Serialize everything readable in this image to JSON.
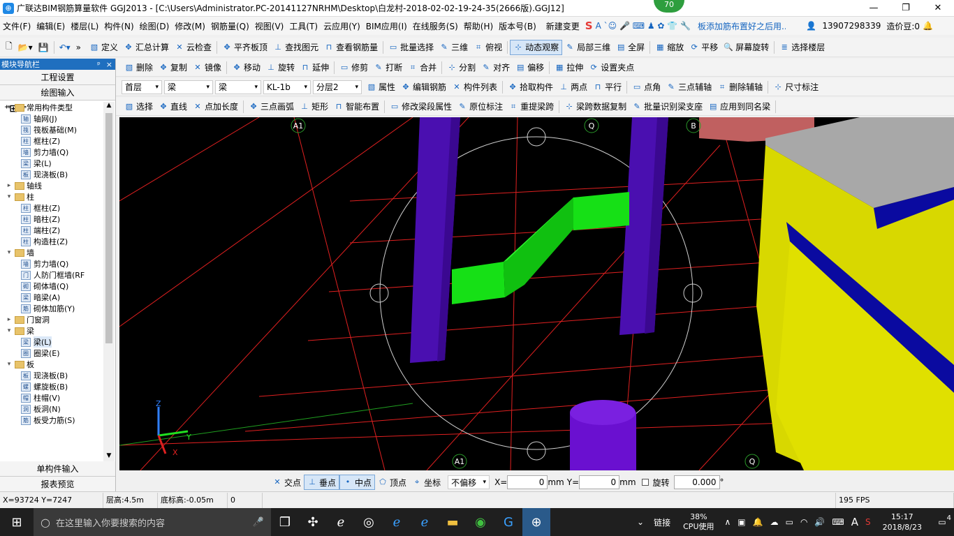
{
  "titlebar": {
    "title": "广联达BIM钢筋算量软件 GGJ2013 - [C:\\Users\\Administrator.PC-20141127NRHM\\Desktop\\白龙村-2018-02-02-19-24-35(2666版).GGJ12]",
    "minimize": "—",
    "maximize": "❐",
    "close": "✕",
    "badge": "70"
  },
  "menubar": {
    "items": [
      "文件(F)",
      "编辑(E)",
      "楼层(L)",
      "构件(N)",
      "绘图(D)",
      "修改(M)",
      "钢筋量(Q)",
      "视图(V)",
      "工具(T)",
      "云应用(Y)",
      "BIM应用(I)",
      "在线服务(S)",
      "帮助(H)",
      "版本号(B)"
    ],
    "news": "新建变更",
    "ad": "板添加筋布置好之后用...",
    "phone": "13907298339",
    "coins": "造价豆:0"
  },
  "toolbar1": {
    "items": [
      "定义",
      "汇总计算",
      "云检查",
      "平齐板顶",
      "查找图元",
      "查看钢筋量",
      "批量选择",
      "三维",
      "俯视",
      "动态观察",
      "局部三维",
      "全屏",
      "缩放",
      "平移",
      "屏幕旋转",
      "选择楼层"
    ]
  },
  "toolbar2": {
    "items": [
      "删除",
      "复制",
      "镜像",
      "移动",
      "旋转",
      "延伸",
      "修剪",
      "打断",
      "合并",
      "分割",
      "对齐",
      "偏移",
      "拉伸",
      "设置夹点"
    ]
  },
  "toolbar3": {
    "floor": "首层",
    "category": "梁",
    "type": "梁",
    "member": "KL-1b",
    "layer": "分层2",
    "items": [
      "属性",
      "编辑钢筋",
      "构件列表",
      "拾取构件",
      "两点",
      "平行",
      "点角",
      "三点辅轴",
      "删除辅轴",
      "尺寸标注"
    ]
  },
  "toolbar4": {
    "items": [
      "选择",
      "直线",
      "点加长度",
      "三点画弧",
      "矩形",
      "智能布置",
      "修改梁段属性",
      "原位标注",
      "重提梁跨",
      "梁跨数据复制",
      "批量识别梁支座",
      "应用到同名梁"
    ]
  },
  "nav": {
    "header": "模块导航栏",
    "pin": "ᵖ",
    "close": "×",
    "btn_project": "工程设置",
    "btn_draw": "绘图输入",
    "btn_single": "单构件输入",
    "btn_report": "报表预览",
    "tree": [
      {
        "level": 0,
        "exp": "▾",
        "folder": true,
        "label": "常用构件类型"
      },
      {
        "level": 1,
        "icon": "轴",
        "label": "轴网(J)"
      },
      {
        "level": 1,
        "icon": "筏",
        "label": "筏板基础(M)"
      },
      {
        "level": 1,
        "icon": "柱",
        "label": "框柱(Z)"
      },
      {
        "level": 1,
        "icon": "墙",
        "label": "剪力墙(Q)"
      },
      {
        "level": 1,
        "icon": "梁",
        "label": "梁(L)"
      },
      {
        "level": 1,
        "icon": "板",
        "label": "现浇板(B)"
      },
      {
        "level": 0,
        "exp": "▸",
        "folder": true,
        "label": "轴线"
      },
      {
        "level": 0,
        "exp": "▾",
        "folder": true,
        "label": "柱"
      },
      {
        "level": 1,
        "icon": "柱",
        "label": "框柱(Z)"
      },
      {
        "level": 1,
        "icon": "柱",
        "label": "暗柱(Z)"
      },
      {
        "level": 1,
        "icon": "柱",
        "label": "端柱(Z)"
      },
      {
        "level": 1,
        "icon": "柱",
        "label": "构造柱(Z)"
      },
      {
        "level": 0,
        "exp": "▾",
        "folder": true,
        "label": "墙"
      },
      {
        "level": 1,
        "icon": "墙",
        "label": "剪力墙(Q)"
      },
      {
        "level": 1,
        "icon": "门",
        "label": "人防门框墙(RF"
      },
      {
        "level": 1,
        "icon": "砌",
        "label": "砌体墙(Q)"
      },
      {
        "level": 1,
        "icon": "梁",
        "label": "暗梁(A)"
      },
      {
        "level": 1,
        "icon": "筋",
        "label": "砌体加筋(Y)"
      },
      {
        "level": 0,
        "exp": "▸",
        "folder": true,
        "label": "门窗洞"
      },
      {
        "level": 0,
        "exp": "▾",
        "folder": true,
        "label": "梁"
      },
      {
        "level": 1,
        "icon": "梁",
        "label": "梁(L)",
        "selected": true
      },
      {
        "level": 1,
        "icon": "圈",
        "label": "圈梁(E)"
      },
      {
        "level": 0,
        "exp": "▾",
        "folder": true,
        "label": "板"
      },
      {
        "level": 1,
        "icon": "板",
        "label": "现浇板(B)"
      },
      {
        "level": 1,
        "icon": "螺",
        "label": "螺旋板(B)"
      },
      {
        "level": 1,
        "icon": "帽",
        "label": "柱帽(V)"
      },
      {
        "level": 1,
        "icon": "洞",
        "label": "板洞(N)"
      },
      {
        "level": 1,
        "icon": "筋",
        "label": "板受力筋(S)"
      }
    ]
  },
  "viewport": {
    "axis_labels": [
      "A1",
      "Q",
      "B",
      "A1",
      "Q",
      "B"
    ],
    "axes": {
      "z": "Z",
      "y": "Y",
      "x": "X"
    },
    "colors": {
      "background": "#000000",
      "grid": "#e02020",
      "column": "#4a0fb0",
      "beam": "#16e016",
      "wall_yellow": "#e0e000",
      "beam_blue": "#0a0aa0"
    }
  },
  "snapbar": {
    "items": [
      "交点",
      "垂点",
      "中点",
      "顶点",
      "坐标"
    ],
    "offset": "不偏移",
    "x_label": "X=",
    "x_value": "0",
    "y_label": "Y=",
    "y_value": "0",
    "unit": "mm",
    "rotate_label": "旋转",
    "rotate_value": "0.000",
    "degree": "°"
  },
  "statusbar": {
    "coords": "X=93724 Y=7247",
    "floor_height": "层高:4.5m",
    "base_height": "底标高:-0.05m",
    "value": "0",
    "fps": "195 FPS"
  },
  "taskbar": {
    "search_placeholder": "在这里输入你要搜索的内容",
    "link": "链接",
    "cpu_percent": "38%",
    "cpu_label": "CPU使用",
    "lang": "A",
    "time": "15:17",
    "date": "2018/8/23",
    "notif": "4"
  }
}
